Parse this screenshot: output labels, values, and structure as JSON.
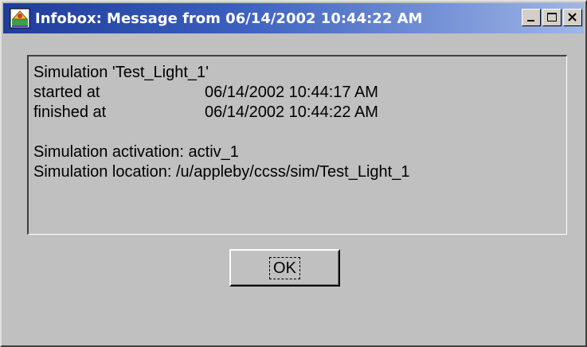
{
  "window": {
    "title": "Infobox: Message from 06/14/2002 10:44:22 AM",
    "icon": "app-icon"
  },
  "title_buttons": {
    "minimize_icon": "minimize-icon",
    "maximize_icon": "maximize-icon",
    "close_icon": "close-icon"
  },
  "message": {
    "line1": "Simulation 'Test_Light_1'",
    "started_label": "started at",
    "started_value": "06/14/2002 10:44:17 AM",
    "finished_label": "finished at",
    "finished_value": "06/14/2002 10:44:22 AM",
    "activation": "Simulation activation: activ_1",
    "location": "Simulation location: /u/appleby/ccss/sim/Test_Light_1"
  },
  "ok_button": {
    "label": "OK"
  },
  "colors": {
    "title_start": "#1f3c9a",
    "title_end": "#9fb6e6",
    "face": "#c0c0c0"
  }
}
